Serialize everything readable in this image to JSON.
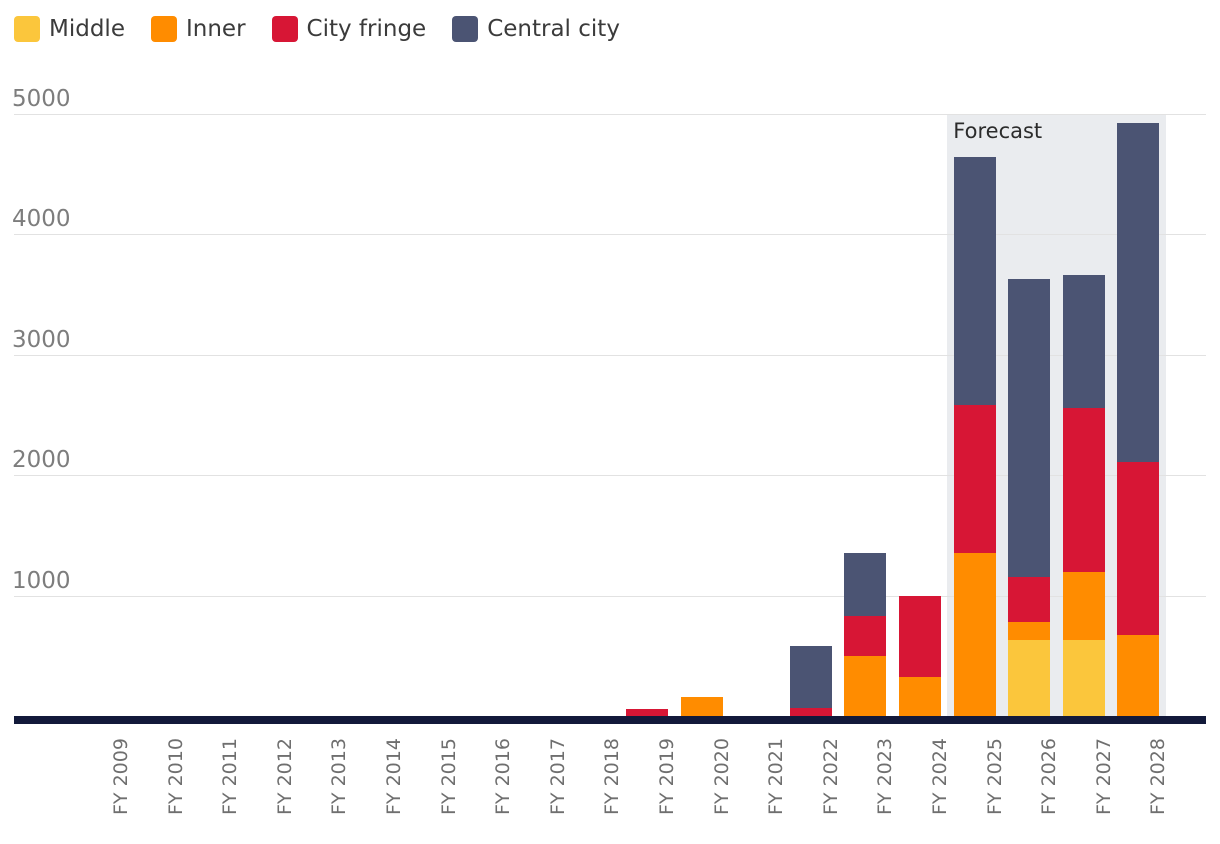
{
  "legend": {
    "items": [
      {
        "label": "Middle",
        "color": "#fbc63c",
        "key": "middle"
      },
      {
        "label": "Inner",
        "color": "#ff8c00",
        "key": "inner"
      },
      {
        "label": "City fringe",
        "color": "#d71635",
        "key": "city_fringe"
      },
      {
        "label": "Central city",
        "color": "#4b5473",
        "key": "central_city"
      }
    ]
  },
  "annotations": {
    "forecast_label": "Forecast"
  },
  "axis": {
    "y_ticks": [
      "1000",
      "2000",
      "3000",
      "4000",
      "5000"
    ],
    "x_labels": [
      "FY 2009",
      "FY 2010",
      "FY 2011",
      "FY 2012",
      "FY 2013",
      "FY 2014",
      "FY 2015",
      "FY 2016",
      "FY 2017",
      "FY 2018",
      "FY 2019",
      "FY 2020",
      "FY 2021",
      "FY 2022",
      "FY 2023",
      "FY 2024",
      "FY 2025",
      "FY 2026",
      "FY 2027",
      "FY 2028"
    ]
  },
  "chart_data": {
    "type": "bar",
    "stacked": true,
    "title": "",
    "xlabel": "",
    "ylabel": "",
    "ylim": [
      0,
      5000
    ],
    "ytick_values": [
      1000,
      2000,
      3000,
      4000,
      5000
    ],
    "grid": true,
    "legend_position": "top-left",
    "categories": [
      "FY 2009",
      "FY 2010",
      "FY 2011",
      "FY 2012",
      "FY 2013",
      "FY 2014",
      "FY 2015",
      "FY 2016",
      "FY 2017",
      "FY 2018",
      "FY 2019",
      "FY 2020",
      "FY 2021",
      "FY 2022",
      "FY 2023",
      "FY 2024",
      "FY 2025",
      "FY 2026",
      "FY 2027",
      "FY 2028"
    ],
    "series": [
      {
        "name": "Middle",
        "color": "#fbc63c",
        "values": [
          0,
          0,
          0,
          0,
          0,
          0,
          0,
          0,
          0,
          0,
          0,
          0,
          0,
          0,
          0,
          0,
          0,
          630,
          630,
          0
        ]
      },
      {
        "name": "Inner",
        "color": "#ff8c00",
        "values": [
          0,
          0,
          0,
          0,
          0,
          0,
          0,
          0,
          0,
          0,
          0,
          158,
          0,
          0,
          500,
          325,
          1355,
          150,
          565,
          670
        ]
      },
      {
        "name": "City fringe",
        "color": "#d71635",
        "values": [
          0,
          0,
          0,
          0,
          0,
          0,
          0,
          0,
          0,
          0,
          58,
          0,
          0,
          66,
          330,
          670,
          1230,
          375,
          1360,
          1440
        ]
      },
      {
        "name": "Central city",
        "color": "#4b5473",
        "values": [
          0,
          0,
          0,
          0,
          0,
          0,
          0,
          0,
          0,
          0,
          0,
          0,
          0,
          515,
          520,
          0,
          2060,
          2475,
          1105,
          2815
        ]
      }
    ],
    "totals": [
      0,
      0,
      0,
      0,
      0,
      0,
      0,
      0,
      0,
      0,
      58,
      158,
      0,
      581,
      1350,
      995,
      4645,
      3630,
      3660,
      4925
    ],
    "forecast_from": "FY 2025",
    "forecast_categories": [
      "FY 2025",
      "FY 2026",
      "FY 2027",
      "FY 2028"
    ],
    "annotation": "Forecast"
  },
  "colors": {
    "baseline": "#12193a",
    "forecast_band": "#eaecef",
    "gridline": "#e2e2e2",
    "tick_text": "#7d7d7d",
    "background": "#ffffff"
  }
}
